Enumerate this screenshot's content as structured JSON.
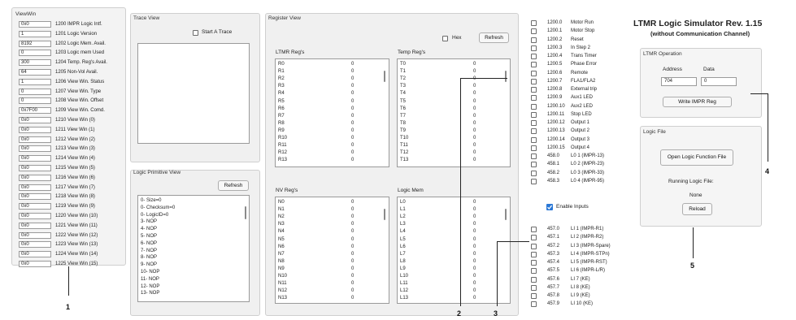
{
  "viewwin": {
    "title": "ViewWin",
    "rows": [
      {
        "value": "0x0",
        "label": "1200 IMPR Logic Intf."
      },
      {
        "value": "1",
        "label": "1201 Logic Version"
      },
      {
        "value": "8192",
        "label": "1202 Logic Mem. Avail."
      },
      {
        "value": "0",
        "label": "1203 Logic mem Used"
      },
      {
        "value": "300",
        "label": "1204 Temp. Reg's Avail."
      },
      {
        "value": "64",
        "label": "1205 Non-Vol Avail."
      },
      {
        "value": "1",
        "label": "1206 View Win. Status"
      },
      {
        "value": "0",
        "label": "1207 View Win. Type"
      },
      {
        "value": "0",
        "label": "1208 View Win. Offset"
      },
      {
        "value": "0x7F00",
        "label": "1209 View Win. Comd."
      },
      {
        "value": "0x0",
        "label": "1210 View Win (0)"
      },
      {
        "value": "0x0",
        "label": "1211 View Win (1)"
      },
      {
        "value": "0x0",
        "label": "1212 View Win (2)"
      },
      {
        "value": "0x0",
        "label": "1213 View Win (3)"
      },
      {
        "value": "0x0",
        "label": "1214 View Win (4)"
      },
      {
        "value": "0x0",
        "label": "1215 View Win (5)"
      },
      {
        "value": "0x0",
        "label": "1216 View Win (6)"
      },
      {
        "value": "0x0",
        "label": "1217 View Win (7)"
      },
      {
        "value": "0x0",
        "label": "1218 View Win (8)"
      },
      {
        "value": "0x0",
        "label": "1219 View Win (9)"
      },
      {
        "value": "0x0",
        "label": "1220 View Win (10)"
      },
      {
        "value": "0x0",
        "label": "1221 View Win (11)"
      },
      {
        "value": "0x0",
        "label": "1222 View Win (12)"
      },
      {
        "value": "0x0",
        "label": "1223 View Win (13)"
      },
      {
        "value": "0x0",
        "label": "1224 View Win (14)"
      },
      {
        "value": "0x0",
        "label": "1225 View Win (15)"
      }
    ]
  },
  "trace": {
    "title": "Trace View",
    "start_label": "Start A Trace"
  },
  "logic_primitive": {
    "title": "Logic Primitive View",
    "refresh": "Refresh",
    "items": [
      "0- Size=0",
      "0- Checksum=0",
      "0- LogicID=0",
      "3- NOP",
      "4- NOP",
      "5- NOP",
      "6- NOP",
      "7- NOP",
      "8- NOP",
      "9- NOP",
      "10- NOP",
      "11- NOP",
      "12- NOP",
      "13- NOP"
    ]
  },
  "register_view": {
    "title": "Register View",
    "hex_label": "Hex",
    "refresh": "Refresh",
    "ltmr": {
      "title": "LTMR Reg's",
      "names": [
        "R0",
        "R1",
        "R2",
        "R3",
        "R4",
        "R5",
        "R6",
        "R7",
        "R8",
        "R9",
        "R10",
        "R11",
        "R12",
        "R13"
      ],
      "values": [
        "0",
        "0",
        "0",
        "0",
        "0",
        "0",
        "0",
        "0",
        "0",
        "0",
        "0",
        "0",
        "0",
        "0"
      ]
    },
    "temp": {
      "title": "Temp Reg's",
      "names": [
        "T0",
        "T1",
        "T2",
        "T3",
        "T4",
        "T5",
        "T6",
        "T7",
        "T8",
        "T9",
        "T10",
        "T11",
        "T12",
        "T13"
      ],
      "values": [
        "0",
        "0",
        "0",
        "0",
        "0",
        "0",
        "0",
        "0",
        "0",
        "0",
        "0",
        "0",
        "0",
        "0"
      ]
    },
    "nv": {
      "title": "NV Reg's",
      "names": [
        "N0",
        "N1",
        "N2",
        "N3",
        "N4",
        "N5",
        "N6",
        "N7",
        "N8",
        "N9",
        "N10",
        "N11",
        "N12",
        "N13"
      ],
      "values": [
        "0",
        "0",
        "0",
        "0",
        "0",
        "0",
        "0",
        "0",
        "0",
        "0",
        "0",
        "0",
        "0",
        "0"
      ]
    },
    "logicmem": {
      "title": "Logic Mem",
      "names": [
        "L0",
        "L1",
        "L2",
        "L3",
        "L4",
        "L5",
        "L6",
        "L7",
        "L8",
        "L9",
        "L10",
        "L11",
        "L12",
        "L13"
      ],
      "values": [
        "0",
        "0",
        "0",
        "0",
        "0",
        "0",
        "0",
        "0",
        "0",
        "0",
        "0",
        "0",
        "0",
        "0"
      ]
    }
  },
  "outputs": [
    {
      "addr": "1200.0",
      "desc": "Motor Run"
    },
    {
      "addr": "1200.1",
      "desc": "Motor Stop"
    },
    {
      "addr": "1200.2",
      "desc": "Reset"
    },
    {
      "addr": "1200.3",
      "desc": "In Step 2"
    },
    {
      "addr": "1200.4",
      "desc": "Trans Timer"
    },
    {
      "addr": "1200.5",
      "desc": "Phase Error"
    },
    {
      "addr": "1200.6",
      "desc": "Remote"
    },
    {
      "addr": "1200.7",
      "desc": "FLA1/FLA2"
    },
    {
      "addr": "1200.8",
      "desc": "External trip"
    },
    {
      "addr": "1200.9",
      "desc": "Aux1 LED"
    },
    {
      "addr": "1200.10",
      "desc": "Aux2 LED"
    },
    {
      "addr": "1200.11",
      "desc": "Stop LED"
    },
    {
      "addr": "1200.12",
      "desc": "Output 1"
    },
    {
      "addr": "1200.13",
      "desc": "Output 2"
    },
    {
      "addr": "1200.14",
      "desc": "Output 3"
    },
    {
      "addr": "1200.15",
      "desc": "Output 4"
    },
    {
      "addr": "458.0",
      "desc": "L0 1 (IMPR-13)"
    },
    {
      "addr": "458.1",
      "desc": "L0 2 (IMPR-23)"
    },
    {
      "addr": "458.2",
      "desc": "L0 3 (IMPR-33)"
    },
    {
      "addr": "458.3",
      "desc": "L0 4 (IMPR-95)"
    }
  ],
  "enable_inputs": "Enable Inputs",
  "inputs": [
    {
      "addr": "457.0",
      "desc": "LI 1 (IMPR-R1)"
    },
    {
      "addr": "457.1",
      "desc": "LI 2 (IMPR-R2)"
    },
    {
      "addr": "457.2",
      "desc": "LI 3 (IMPR-Spare)"
    },
    {
      "addr": "457.3",
      "desc": "LI 4 (IMPR-STPn)"
    },
    {
      "addr": "457.4",
      "desc": "LI 5 (IMPR-RST)"
    },
    {
      "addr": "457.5",
      "desc": "LI 6 (IMPR-L/R)"
    },
    {
      "addr": "457.6",
      "desc": "LI 7 (KE)"
    },
    {
      "addr": "457.7",
      "desc": "LI 8 (KE)"
    },
    {
      "addr": "457.8",
      "desc": "LI 9 (KE)"
    },
    {
      "addr": "457.9",
      "desc": "LI 10 (KE)"
    }
  ],
  "header": {
    "title": "LTMR Logic Simulator Rev. 1.15",
    "subtitle": "(without Communication Channel)"
  },
  "ltmr_operation": {
    "title": "LTMR Operation",
    "address_label": "Address",
    "data_label": "Data",
    "address_value": "704",
    "data_value": "0",
    "write_button": "Write IMPR Reg"
  },
  "logic_file": {
    "title": "Logic File",
    "open_button": "Open Logic Function File",
    "running_label": "Running Logic File:",
    "running_value": "None",
    "reload_button": "Reload"
  },
  "annotations": [
    "1",
    "2",
    "3",
    "4",
    "5"
  ],
  "colors": {
    "accent": "#2b78d6",
    "panel_bg": "#f0f0f0",
    "border": "#cfcfcf"
  }
}
